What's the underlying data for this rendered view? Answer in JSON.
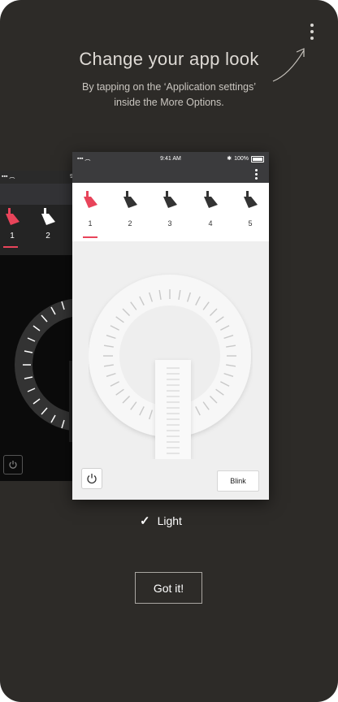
{
  "overlay": {
    "title": "Change your app look",
    "subtitle_line1": "By tapping on the ‘Application settings’",
    "subtitle_line2": "inside the More Options.",
    "more_icon": "more-vertical-icon",
    "got_it_label": "Got it!",
    "theme_option": {
      "label": "Light",
      "selected": true
    }
  },
  "preview_light": {
    "status_time": "9:41 AM",
    "battery": "100%",
    "lamps": [
      {
        "label": "1",
        "selected": true
      },
      {
        "label": "2",
        "selected": false
      },
      {
        "label": "3",
        "selected": false
      },
      {
        "label": "4",
        "selected": false
      },
      {
        "label": "5",
        "selected": false
      }
    ],
    "blink_label": "Blink",
    "power_icon": "power-icon"
  },
  "preview_dark": {
    "lamps": [
      {
        "label": "1",
        "selected": true
      },
      {
        "label": "2",
        "selected": false
      }
    ]
  },
  "colors": {
    "background": "#2d2b28",
    "accent": "#e8445a",
    "lamp_inactive": "#333333",
    "lamp_dark_theme": "#ffffff"
  }
}
